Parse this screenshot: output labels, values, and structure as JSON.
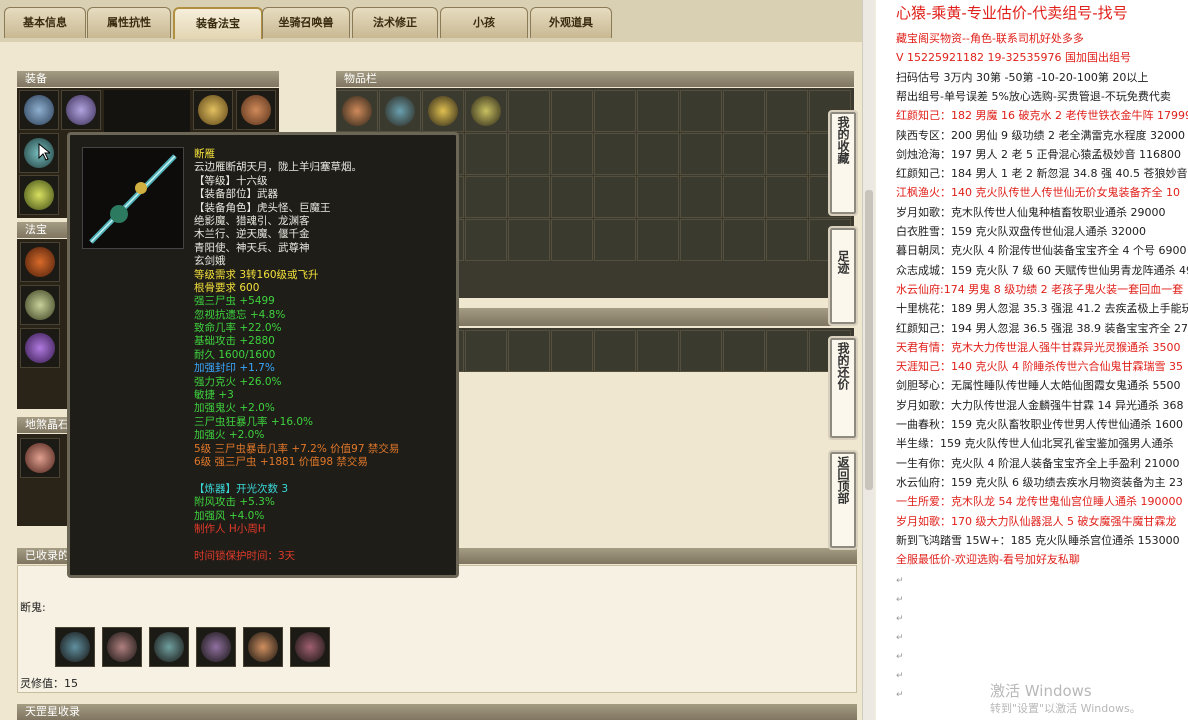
{
  "tabs": [
    "基本信息",
    "属性抗性",
    "装备法宝",
    "坐骑召唤兽",
    "法术修正",
    "小孩",
    "外观道具"
  ],
  "sections": {
    "equipment": "装备",
    "items": "物品栏",
    "fabao": "法宝",
    "dihun": "地煞晶石",
    "collected": "已收录的",
    "tiangang": "天罡星收录"
  },
  "collected_label": "断鬼:",
  "lingxiu_label": "灵修值：15",
  "tooltip": [
    {
      "t": "断雁",
      "c": "yel"
    },
    {
      "t": "云边雁断胡天月，陇上羊归塞草烟。",
      "c": "wht"
    },
    {
      "t": "【等级】十六级",
      "c": "wht"
    },
    {
      "t": "【装备部位】武器",
      "c": "wht"
    },
    {
      "t": "【装备角色】虎头怪、巨魔王",
      "c": "wht"
    },
    {
      "t": "绝影魔、猎魂引、龙渊客",
      "c": "wht"
    },
    {
      "t": "木兰行、逆天魔、偃千金",
      "c": "wht"
    },
    {
      "t": "青阳使、神天兵、武尊神",
      "c": "wht"
    },
    {
      "t": "玄剑娥",
      "c": "wht"
    },
    {
      "t": "等级需求 3转160级或飞升",
      "c": "yel"
    },
    {
      "t": "根骨要求 600",
      "c": "yel"
    },
    {
      "t": "强三尸虫 +5499",
      "c": "grn"
    },
    {
      "t": "忽视抗遗忘 +4.8%",
      "c": "grn"
    },
    {
      "t": "致命几率 +22.0%",
      "c": "grn"
    },
    {
      "t": "基础攻击 +2880",
      "c": "grn"
    },
    {
      "t": "耐久 1600/1600",
      "c": "grn"
    },
    {
      "t": "加强封印 +1.7%",
      "c": "blu"
    },
    {
      "t": "强力克火 +26.0%",
      "c": "grn"
    },
    {
      "t": "敏捷 +3",
      "c": "grn"
    },
    {
      "t": "加强鬼火 +2.0%",
      "c": "grn"
    },
    {
      "t": "三尸虫狂暴几率 +16.0%",
      "c": "grn"
    },
    {
      "t": "加强火 +2.0%",
      "c": "grn"
    },
    {
      "t": "5级 三尸虫暴击几率 +7.2% 价值97 禁交易",
      "c": "org"
    },
    {
      "t": "6级 强三尸虫 +1881 价值98 禁交易",
      "c": "org"
    },
    {
      "t": "",
      "c": "wht"
    },
    {
      "t": "【炼器】开光次数 3",
      "c": "cyan"
    },
    {
      "t": "附风攻击 +5.3%",
      "c": "grn"
    },
    {
      "t": "加强风 +4.0%",
      "c": "grn"
    },
    {
      "t": "制作人 H小周H",
      "c": "red"
    },
    {
      "t": "",
      "c": "wht"
    },
    {
      "t": "时间锁保护时间：3天",
      "c": "red"
    }
  ],
  "side_buttons": [
    "我的收藏",
    "足迹",
    "我的还价",
    "返回顶部"
  ],
  "doc_lines": [
    {
      "t": "心猿-乘黄-专业估价-代卖组号-找号",
      "c": "red",
      "big": true
    },
    {
      "t": "藏宝阁买物资--角色-联系司机好处多多",
      "c": "red"
    },
    {
      "t": "V 15225921182  19-32535976 国加国出组号",
      "c": "red"
    },
    {
      "t": "扫码估号 3万内 30第 -50第 -10-20-100第 20以上",
      "c": "blk"
    },
    {
      "t": "帮出组号-单号误差 5%放心选购-买贵管退-不玩免费代卖",
      "c": "blk"
    },
    {
      "t": "红颜知己：182 男魔 16 破克水 2 老传世铁衣金牛阵 17999",
      "c": "red"
    },
    {
      "t": "陕西专区：200 男仙 9 级功绩 2 老全满雷克水程度 32000",
      "c": "blk"
    },
    {
      "t": "剑烛沧海：197 男人 2 老 5 正骨混心猿孟极妙音 116800",
      "c": "blk"
    },
    {
      "t": "红颜知己：184 男人 1 老 2 新忽混 34.8 强 40.5 苍狼妙音 22",
      "c": "blk"
    },
    {
      "t": "江枫渔火：140 克火队传世人传世仙无价女鬼装备齐全 10",
      "c": "red"
    },
    {
      "t": "岁月如歌：克木队传世人仙鬼种植畜牧职业通杀 29000",
      "c": "blk"
    },
    {
      "t": "白衣胜雪：159 克火队双盘传世仙混人通杀 32000",
      "c": "blk"
    },
    {
      "t": "暮日朝凤：克火队 4 阶混传世仙装备宝宝齐全 4 个号 6900",
      "c": "blk"
    },
    {
      "t": "众志成城：159 克火队 7 级 60 天赋传世仙男青龙阵通杀 49",
      "c": "blk"
    },
    {
      "t": "水云仙府:174 男鬼 8 级功绩 2 老孩子鬼火装一套回血一套",
      "c": "red"
    },
    {
      "t": "十里桃花：189 男人忽混 35.3 强混 41.2 去疾孟极上手能玩",
      "c": "blk"
    },
    {
      "t": "红颜知己：194 男人忽混 36.5 强混 38.9 装备宝宝齐全 2750",
      "c": "blk"
    },
    {
      "t": "天君有情：克木大力传世混人强牛甘霖异光灵猴通杀 3500",
      "c": "red"
    },
    {
      "t": "天涯知己：140 克火队 4 阶睡杀传世六合仙鬼甘霖瑞雪 35",
      "c": "red"
    },
    {
      "t": "剑胆琴心：无属性睡队传世睡人太皓仙图霞女鬼通杀 5500",
      "c": "blk"
    },
    {
      "t": "岁月如歌：大力队传世混人金麟强牛甘霖 14 异光通杀 368",
      "c": "blk"
    },
    {
      "t": "一曲春秋：159 克火队畜牧职业传世男人传世仙通杀 1600",
      "c": "blk"
    },
    {
      "t": "半生缘：159 克火队传世人仙北冥孔雀宝鉴加强男人通杀",
      "c": "blk"
    },
    {
      "t": "一生有你：克火队 4 阶混人装备宝宝齐全上手盈利 21000",
      "c": "blk"
    },
    {
      "t": "水云仙府：159 克火队 6 级功绩去疾水月物资装备为主 23",
      "c": "blk"
    },
    {
      "t": "一生所爱：克木队龙 54 龙传世鬼仙宫位睡人通杀 190000",
      "c": "red"
    },
    {
      "t": "岁月如歌：170 级大力队仙器混人 5 破女魔强牛魔甘霖龙",
      "c": "red"
    },
    {
      "t": "新到飞鸿踏雪 15W+：185 克火队睡杀宫位通杀 153000",
      "c": "blk"
    },
    {
      "t": "全服最低价-欢迎选购-看号加好友私聊",
      "c": "red"
    }
  ],
  "watermark": {
    "line1": "激活 Windows",
    "line2": "转到\"设置\"以激活 Windows。"
  },
  "colors": {
    "red": "#e0201a",
    "tooltip_bg": "#1f1d18",
    "panel_bg": "#efe7cf"
  }
}
